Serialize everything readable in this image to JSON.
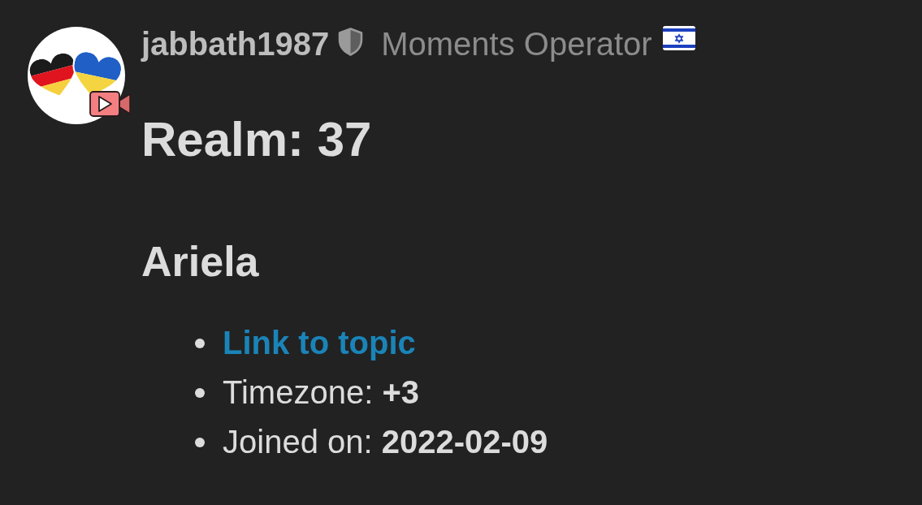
{
  "user": {
    "username": "jabbath1987",
    "title": "Moments Operator"
  },
  "heading": "Realm: 37",
  "subheading": "Ariela",
  "details": [
    {
      "kind": "link",
      "text": "Link to topic"
    },
    {
      "kind": "field",
      "text": "Timezone: **+3**"
    },
    {
      "kind": "field",
      "text": "Joined on: **2022-02-09**"
    }
  ]
}
